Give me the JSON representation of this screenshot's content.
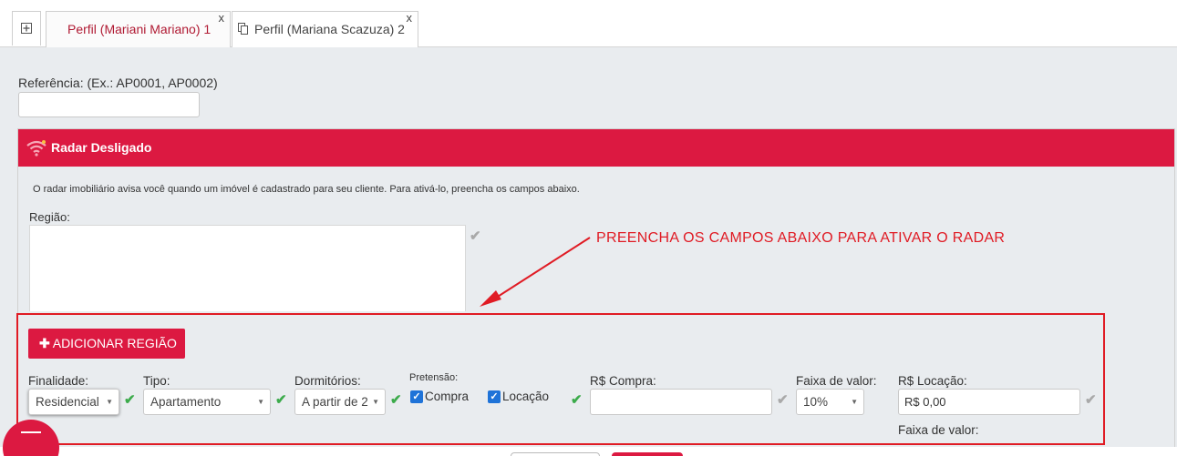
{
  "tabs": {
    "add_icon": "plus-square-icon",
    "items": [
      {
        "label": "Perfil (Mariani Mariano) 1",
        "close": "x",
        "active": true
      },
      {
        "label": "Perfil (Mariana Scazuza) 2",
        "close": "x",
        "active": false
      }
    ]
  },
  "reference": {
    "label": "Referência: (Ex.: AP0001, AP0002)",
    "value": ""
  },
  "radar": {
    "title": "Radar Desligado",
    "description": "O radar imobiliário avisa você quando um imóvel é cadastrado para seu cliente. Para ativá-lo, preencha os campos abaixo.",
    "region_label": "Região:",
    "add_region_button": "ADICIONAR REGIÃO",
    "color": "#dc1941"
  },
  "annotation": {
    "text": "PREENCHA OS CAMPOS ABAIXO PARA ATIVAR O RADAR",
    "color": "#e01b24"
  },
  "fields": {
    "finalidade": {
      "label": "Finalidade:",
      "value": "Residencial"
    },
    "tipo": {
      "label": "Tipo:",
      "value": "Apartamento"
    },
    "dormitorios": {
      "label": "Dormitórios:",
      "value": "A partir de 2"
    },
    "pretensao": {
      "label": "Pretensão:",
      "compra": "Compra",
      "locacao": "Locação",
      "compra_checked": true,
      "locacao_checked": true
    },
    "compra_valor": {
      "label": "R$ Compra:",
      "value": ""
    },
    "faixa_compra": {
      "label": "Faixa de valor:",
      "value": "10%"
    },
    "locacao_valor": {
      "label": "R$ Locação:",
      "value": "R$ 0,00"
    },
    "faixa_locacao": {
      "label": "Faixa de valor:"
    }
  },
  "glyphs": {
    "check": "✔",
    "caret": "▼",
    "close": "x",
    "checkbox_mark": "✓"
  }
}
